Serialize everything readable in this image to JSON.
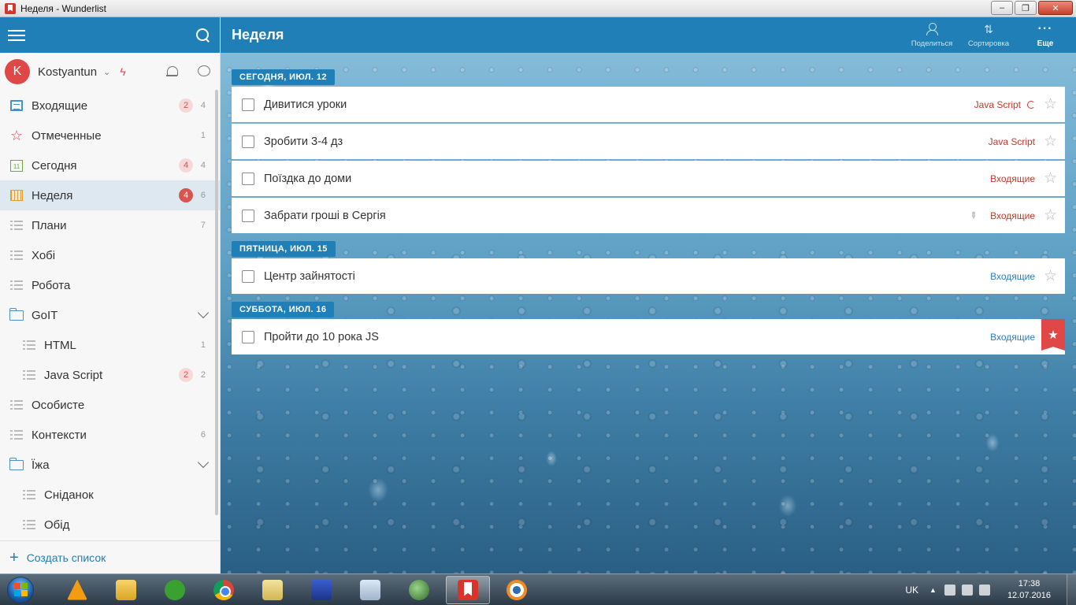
{
  "window": {
    "title": "Неделя - Wunderlist",
    "minimize": "‒",
    "maximize": "❐",
    "close": "✕"
  },
  "colors": {
    "accent": "#1f7fb6",
    "red": "#e04848",
    "sidebar_bg": "#f7f7f7"
  },
  "sidebar": {
    "user": {
      "initial": "K",
      "name": "Kostyantun"
    },
    "items": [
      {
        "label": "Входящие",
        "badge": "2",
        "count": "4",
        "icon": "inbox-icon"
      },
      {
        "label": "Отмеченные",
        "count": "1",
        "icon": "star-icon"
      },
      {
        "label": "Сегодня",
        "badge": "4",
        "count": "4",
        "icon": "today-icon",
        "icon_text": "11"
      },
      {
        "label": "Неделя",
        "badge": "4",
        "count": "6",
        "icon": "week-icon",
        "active": true
      },
      {
        "label": "Плани",
        "count": "7",
        "icon": "list-icon"
      },
      {
        "label": "Хобі",
        "icon": "list-icon"
      },
      {
        "label": "Робота",
        "icon": "list-icon"
      },
      {
        "label": "GoIT",
        "icon": "folder-icon",
        "folder": true
      },
      {
        "label": "HTML",
        "count": "1",
        "icon": "list-icon",
        "sub": true
      },
      {
        "label": "Java Script",
        "badge": "2",
        "count": "2",
        "icon": "list-icon",
        "sub": true
      },
      {
        "label": "Особисте",
        "icon": "list-icon"
      },
      {
        "label": "Контексти",
        "count": "6",
        "icon": "list-icon"
      },
      {
        "label": "Їжа",
        "icon": "folder-icon",
        "folder": true
      },
      {
        "label": "Сніданок",
        "icon": "list-icon",
        "sub": true
      },
      {
        "label": "Обід",
        "icon": "list-icon",
        "sub": true
      }
    ],
    "create_label": "Создать список"
  },
  "main": {
    "list_title": "Неделя",
    "actions": [
      {
        "label": "Поделиться",
        "icon": "share-icon"
      },
      {
        "label": "Сортировка",
        "icon": "sort-icon",
        "glyph": "⇅"
      },
      {
        "label": "Еще",
        "icon": "more-icon",
        "glyph": "···"
      }
    ],
    "groups": [
      {
        "day": "СЕГОДНЯ, ИЮЛ. 12",
        "tasks": [
          {
            "title": "Дивитися уроки",
            "list": "Java Script",
            "list_color": "red",
            "repeat": true,
            "starred": false
          },
          {
            "title": "Зробити 3-4 дз",
            "list": "Java Script",
            "list_color": "red",
            "starred": false
          },
          {
            "title": "Поїздка до доми",
            "list": "Входящие",
            "list_color": "red",
            "starred": false
          },
          {
            "title": "Забрати гроші в Сергія",
            "list": "Входящие",
            "list_color": "red",
            "pinned": true,
            "starred": false
          }
        ]
      },
      {
        "day": "ПЯТНИЦА, ИЮЛ. 15",
        "tasks": [
          {
            "title": "Центр зайнятості",
            "list": "Входящие",
            "list_color": "blue",
            "starred": false
          }
        ]
      },
      {
        "day": "СУББОТА, ИЮЛ. 16",
        "tasks": [
          {
            "title": "Пройти до 10 рока JS",
            "list": "Входящие",
            "list_color": "blue",
            "starred": true
          }
        ]
      }
    ]
  },
  "taskbar": {
    "apps": [
      "aimp-icon",
      "explorer-icon",
      "utorrent-icon",
      "chrome-icon",
      "search-files-icon",
      "save-icon",
      "keyboard-icon",
      "globe-icon",
      "wunderlist-icon",
      "eye-icon"
    ],
    "active_app": "wunderlist-icon",
    "tray": {
      "lang": "UK",
      "arrow": "▲",
      "time": "17:38",
      "date": "12.07.2016"
    }
  }
}
